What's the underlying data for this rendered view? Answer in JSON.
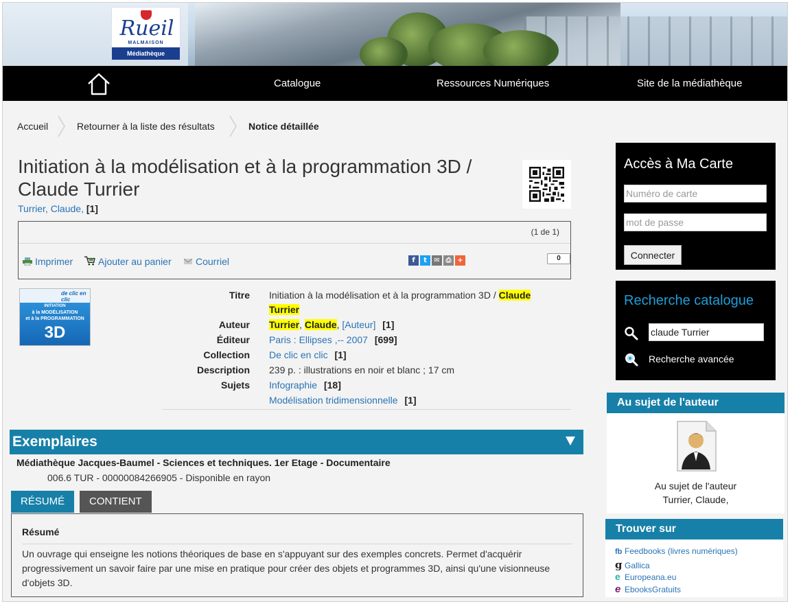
{
  "header": {
    "logo": {
      "wordmark": "Rueil",
      "sub": "MALMAISON",
      "band": "Médiathèque"
    }
  },
  "nav": {
    "items": [
      {
        "label": "Catalogue"
      },
      {
        "label": "Ressources Numériques"
      },
      {
        "label": "Site de la médiathèque"
      }
    ]
  },
  "breadcrumb": [
    {
      "label": "Accueil"
    },
    {
      "label": "Retourner à la liste des résultats"
    },
    {
      "label": "Notice détaillée"
    }
  ],
  "notice": {
    "title": "Initiation à la modélisation et à la programmation 3D / Claude Turrier",
    "author_link": "Turrier, Claude,",
    "author_count": "[1]",
    "pager": "(1 de 1)",
    "tools": {
      "print": "Imprimer",
      "cart": "Ajouter au panier",
      "mail": "Courriel"
    },
    "share_count": "0",
    "share_icons": [
      "facebook-icon",
      "twitter-icon",
      "email-icon",
      "print-icon",
      "plus-icon"
    ],
    "cover": {
      "line1": "INITIATION",
      "line2": "à la MODÉLISATION",
      "line3": "et à la PROGRAMMATION",
      "line4": "3D",
      "series": "de clic en clic"
    },
    "fields": {
      "titre_label": "Titre",
      "titre_value": "Initiation à la modélisation et à la programmation 3D /",
      "titre_hl1": "Claude",
      "titre_hl2": "Turrier",
      "auteur_label": "Auteur",
      "auteur_hl1": "Turrier",
      "auteur_hl2": "Claude",
      "auteur_role": "[Auteur]",
      "auteur_count": "[1]",
      "editeur_label": "Éditeur",
      "editeur_value": "Paris : Ellipses ,-- 2007",
      "editeur_count": "[699]",
      "collection_label": "Collection",
      "collection_value": "De clic en clic",
      "collection_count": "[1]",
      "description_label": "Description",
      "description_value": "239 p. : illustrations en noir et blanc ; 17 cm",
      "sujets_label": "Sujets",
      "sujet1": "Infographie",
      "sujet1_count": "[18]",
      "sujet2": "Modélisation tridimensionnelle",
      "sujet2_count": "[1]"
    }
  },
  "exemplaires": {
    "heading": "Exemplaires",
    "location": "Médiathèque Jacques-Baumel - Sciences et techniques. 1er Etage - Documentaire",
    "item": "006.6 TUR - 00000084266905 - Disponible en rayon"
  },
  "tabs": [
    {
      "label": "RÉSUMÉ",
      "color": "#1780a8"
    },
    {
      "label": "CONTIENT",
      "color": "#555555"
    }
  ],
  "resume": {
    "heading": "Résumé",
    "text": "Un ouvrage qui enseigne les notions théoriques de base en s'appuyant sur des exemples concrets. Permet d'acquérir progressivement un savoir faire par une mise en pratique pour créer des objets et programmes 3D, ainsi qu'une visionneuse d'objets 3D."
  },
  "sidebar": {
    "card": {
      "heading": "Accès à Ma Carte",
      "card_placeholder": "Numéro de carte",
      "password_placeholder": "mot de passe",
      "connect": "Connecter"
    },
    "search": {
      "heading": "Recherche catalogue",
      "query": "claude Turrier",
      "advanced": "Recherche avancée"
    },
    "author": {
      "heading": "Au sujet de l'auteur",
      "caption1": "Au sujet de l'auteur",
      "caption2": "Turrier, Claude,"
    },
    "find": {
      "heading": "Trouver sur",
      "links": [
        {
          "glyph": "fb",
          "label": "Feedbooks (livres numériques)"
        },
        {
          "glyph": "g",
          "label": "Gallica"
        },
        {
          "glyph": "e",
          "label": "Europeana.eu"
        },
        {
          "glyph": "e",
          "label": "EbooksGratuits"
        }
      ]
    }
  },
  "colors": {
    "accent": "#1780a8",
    "link": "#2a73b5",
    "highlight": "#ffff00",
    "nav": "#000000"
  }
}
